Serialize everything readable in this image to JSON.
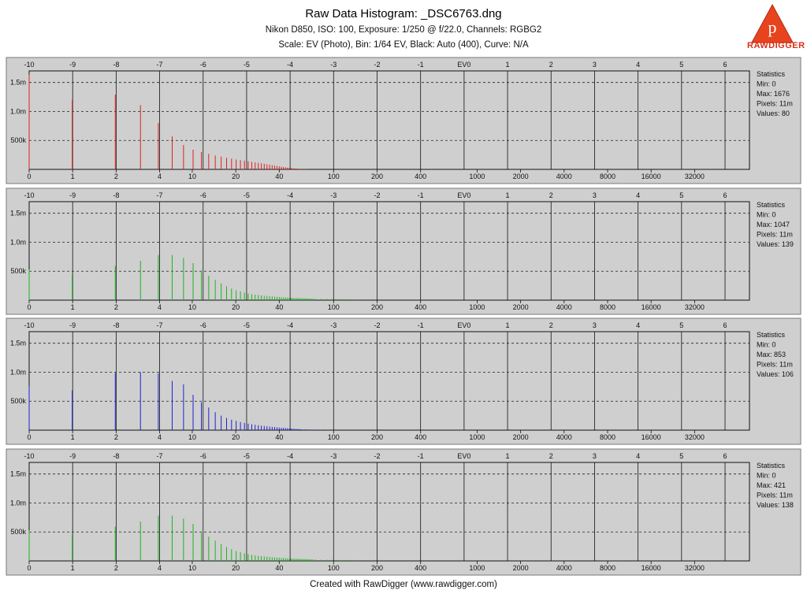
{
  "header": {
    "title": "Raw Data Histogram: _DSC6763.dng",
    "subtitle1": "Nikon D850, ISO: 100, Exposure: 1/250 @ f/22.0, Channels: RGBG2",
    "subtitle2": "Scale: EV (Photo), Bin: 1/64 EV, Black: Auto (400), Curve: N/A"
  },
  "logo": {
    "text": "RAWDIGGER",
    "letter": "p",
    "color": "#e8431f"
  },
  "footer": "Created with RawDigger (www.rawdigger.com)",
  "colors": {
    "panel": "#cfcfcf",
    "grid": "#111111"
  },
  "chart_data": [
    {
      "type": "bar",
      "channel": "R",
      "color": "#e02020",
      "top_ticks": [
        "-10",
        "-9",
        "-8",
        "-7",
        "-6",
        "-5",
        "-4",
        "-3",
        "-2",
        "-1",
        "EV0",
        "1",
        "2",
        "3",
        "4",
        "5",
        "6"
      ],
      "bottom_ticks": [
        "0",
        "1",
        "2",
        "4",
        "10",
        "20",
        "40",
        "100",
        "200",
        "400",
        "1000",
        "2000",
        "4000",
        "8000",
        "16000",
        "32000"
      ],
      "y_ticks": [
        "1.5m",
        "1.0m",
        "500k"
      ],
      "ylim": [
        0,
        1700000
      ],
      "x": [
        0,
        1,
        2,
        3,
        4,
        5,
        6,
        7,
        8,
        9,
        10,
        11,
        12,
        13,
        14,
        15,
        16,
        17,
        18,
        19,
        20,
        21,
        22,
        23,
        24,
        25,
        26,
        27,
        28,
        29,
        30,
        31,
        32,
        33,
        34,
        35,
        36,
        37,
        38,
        39,
        40,
        41,
        42,
        43,
        44,
        45
      ],
      "values": [
        1640000,
        1200000,
        1290000,
        1110000,
        800000,
        570000,
        420000,
        340000,
        300000,
        270000,
        240000,
        220000,
        200000,
        185000,
        170000,
        160000,
        150000,
        140000,
        130000,
        120000,
        112000,
        104000,
        96000,
        88000,
        80000,
        72000,
        65000,
        58000,
        52000,
        46000,
        40000,
        35000,
        30000,
        26000,
        22000,
        18000,
        15000,
        12000,
        10000,
        8000,
        6000,
        5000,
        4000,
        3000,
        2000,
        1000
      ],
      "stats": {
        "title": "Statistics",
        "min": "Min: 0",
        "max": "Max: 1676",
        "pixels": "Pixels: 11m",
        "values": "Values: 80"
      }
    },
    {
      "type": "bar",
      "channel": "G",
      "color": "#1eb41e",
      "top_ticks": [
        "-10",
        "-9",
        "-8",
        "-7",
        "-6",
        "-5",
        "-4",
        "-3",
        "-2",
        "-1",
        "EV0",
        "1",
        "2",
        "3",
        "4",
        "5",
        "6"
      ],
      "bottom_ticks": [
        "0",
        "1",
        "2",
        "4",
        "10",
        "20",
        "40",
        "100",
        "200",
        "400",
        "1000",
        "2000",
        "4000",
        "8000",
        "16000",
        "32000"
      ],
      "y_ticks": [
        "1.5m",
        "1.0m",
        "500k"
      ],
      "ylim": [
        0,
        1700000
      ],
      "x": [
        0,
        1,
        2,
        3,
        4,
        5,
        6,
        7,
        8,
        9,
        10,
        11,
        12,
        13,
        14,
        15,
        16,
        17,
        18,
        19,
        20,
        21,
        22,
        23,
        24,
        25,
        26,
        27,
        28,
        29,
        30,
        31,
        32,
        33,
        34,
        35,
        36,
        37,
        38,
        39,
        40,
        41,
        42,
        43,
        44,
        45,
        46,
        47,
        48,
        50,
        55,
        60,
        65,
        70,
        75,
        80,
        85,
        90,
        95,
        100
      ],
      "values": [
        530000,
        450000,
        590000,
        680000,
        780000,
        780000,
        730000,
        640000,
        510000,
        420000,
        350000,
        290000,
        240000,
        200000,
        170000,
        150000,
        130000,
        115000,
        105000,
        95000,
        88000,
        82000,
        77000,
        72000,
        68000,
        64000,
        60000,
        57000,
        54000,
        51000,
        48000,
        46000,
        44000,
        42000,
        40000,
        38000,
        36000,
        35000,
        34000,
        33000,
        32000,
        31000,
        30000,
        29000,
        28000,
        27000,
        26000,
        25000,
        24000,
        23000,
        22000,
        21000,
        20000,
        19000,
        18000,
        17000,
        16000,
        15000,
        14000,
        13000
      ],
      "stats": {
        "title": "Statistics",
        "min": "Min: 0",
        "max": "Max: 1047",
        "pixels": "Pixels: 11m",
        "values": "Values: 139"
      }
    },
    {
      "type": "bar",
      "channel": "B",
      "color": "#2020d0",
      "top_ticks": [
        "-10",
        "-9",
        "-8",
        "-7",
        "-6",
        "-5",
        "-4",
        "-3",
        "-2",
        "-1",
        "EV0",
        "1",
        "2",
        "3",
        "4",
        "5",
        "6"
      ],
      "bottom_ticks": [
        "0",
        "1",
        "2",
        "4",
        "10",
        "20",
        "40",
        "100",
        "200",
        "400",
        "1000",
        "2000",
        "4000",
        "8000",
        "16000",
        "32000"
      ],
      "y_ticks": [
        "1.5m",
        "1.0m",
        "500k"
      ],
      "ylim": [
        0,
        1700000
      ],
      "x": [
        0,
        1,
        2,
        3,
        4,
        5,
        6,
        7,
        8,
        9,
        10,
        11,
        12,
        13,
        14,
        15,
        16,
        17,
        18,
        19,
        20,
        21,
        22,
        23,
        24,
        25,
        26,
        27,
        28,
        29,
        30,
        31,
        32,
        33,
        34,
        35,
        36,
        37,
        38,
        39,
        40,
        42,
        44,
        46,
        48,
        50,
        55,
        60,
        65,
        70,
        75,
        80,
        90,
        100
      ],
      "values": [
        760000,
        690000,
        990000,
        1000000,
        980000,
        850000,
        790000,
        610000,
        480000,
        390000,
        310000,
        250000,
        210000,
        180000,
        160000,
        140000,
        125000,
        112000,
        100000,
        92000,
        84000,
        78000,
        72000,
        66000,
        61000,
        56000,
        52000,
        48000,
        44000,
        41000,
        38000,
        35000,
        32000,
        29000,
        26000,
        24000,
        22000,
        20000,
        18000,
        16000,
        14000,
        12000,
        11000,
        10000,
        9000,
        8000,
        7000,
        6000,
        5000,
        4000,
        3000,
        2000,
        1500,
        1000
      ],
      "stats": {
        "title": "Statistics",
        "min": "Min: 0",
        "max": "Max: 853",
        "pixels": "Pixels: 11m",
        "values": "Values: 106"
      }
    },
    {
      "type": "bar",
      "channel": "G2",
      "color": "#1eb41e",
      "top_ticks": [
        "-10",
        "-9",
        "-8",
        "-7",
        "-6",
        "-5",
        "-4",
        "-3",
        "-2",
        "-1",
        "EV0",
        "1",
        "2",
        "3",
        "4",
        "5",
        "6"
      ],
      "bottom_ticks": [
        "0",
        "1",
        "2",
        "4",
        "10",
        "20",
        "40",
        "100",
        "200",
        "400",
        "1000",
        "2000",
        "4000",
        "8000",
        "16000",
        "32000"
      ],
      "y_ticks": [
        "1.5m",
        "1.0m",
        "500k"
      ],
      "ylim": [
        0,
        1700000
      ],
      "x": [
        0,
        1,
        2,
        3,
        4,
        5,
        6,
        7,
        8,
        9,
        10,
        11,
        12,
        13,
        14,
        15,
        16,
        17,
        18,
        19,
        20,
        21,
        22,
        23,
        24,
        25,
        26,
        27,
        28,
        29,
        30,
        31,
        32,
        33,
        34,
        35,
        36,
        37,
        38,
        39,
        40,
        41,
        42,
        43,
        44,
        45,
        46,
        47,
        48,
        50,
        55,
        60,
        65,
        70,
        75,
        80,
        85,
        90,
        95,
        100
      ],
      "values": [
        530000,
        450000,
        590000,
        680000,
        780000,
        780000,
        730000,
        640000,
        510000,
        420000,
        350000,
        290000,
        240000,
        200000,
        170000,
        150000,
        130000,
        115000,
        105000,
        95000,
        88000,
        82000,
        77000,
        72000,
        68000,
        64000,
        60000,
        57000,
        54000,
        51000,
        48000,
        46000,
        44000,
        42000,
        40000,
        38000,
        36000,
        35000,
        34000,
        33000,
        32000,
        31000,
        30000,
        29000,
        28000,
        27000,
        26000,
        25000,
        24000,
        23000,
        22000,
        21000,
        20000,
        19000,
        18000,
        17000,
        16000,
        15000,
        14000,
        13000
      ],
      "stats": {
        "title": "Statistics",
        "min": "Min: 0",
        "max": "Max: 421",
        "pixels": "Pixels: 11m",
        "values": "Values: 138"
      }
    }
  ]
}
